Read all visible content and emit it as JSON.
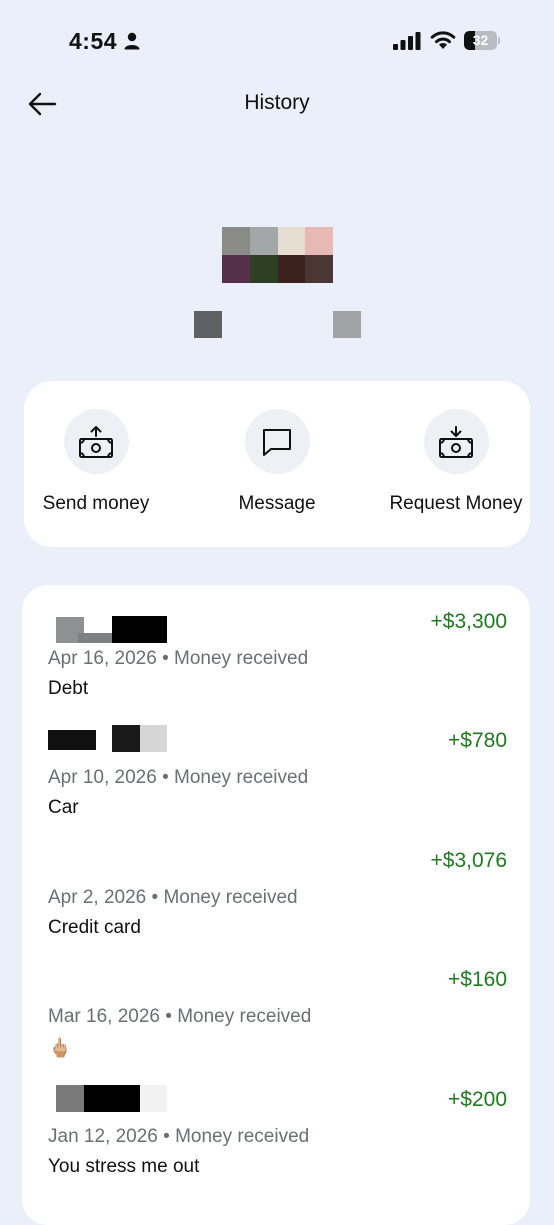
{
  "status_bar": {
    "time": "4:54",
    "battery_level": "32",
    "battery_fraction": 0.32
  },
  "header": {
    "title": "History"
  },
  "actions": [
    {
      "label": "Send money",
      "icon": "send-money-icon"
    },
    {
      "label": "Message",
      "icon": "message-icon"
    },
    {
      "label": "Request Money",
      "icon": "request-money-icon"
    }
  ],
  "transactions": [
    {
      "amount": "+$3,300",
      "date": "Apr 16, 2026",
      "type": "Money received",
      "note": "Debt"
    },
    {
      "amount": "+$780",
      "date": "Apr 10, 2026",
      "type": "Money received",
      "note": "Car"
    },
    {
      "amount": "+$3,076",
      "date": "Apr 2, 2026",
      "type": "Money received",
      "note": "Credit card"
    },
    {
      "amount": "+$160",
      "date": "Mar 16, 2026",
      "type": "Money received",
      "note": "🖕🏼"
    },
    {
      "amount": "+$200",
      "date": "Jan 12, 2026",
      "type": "Money received",
      "note": "You stress me out"
    }
  ],
  "colors": {
    "background": "#ebeff9",
    "card": "#ffffff",
    "positive_amount": "#1f7a1f",
    "secondary_text": "#6b6e74"
  }
}
